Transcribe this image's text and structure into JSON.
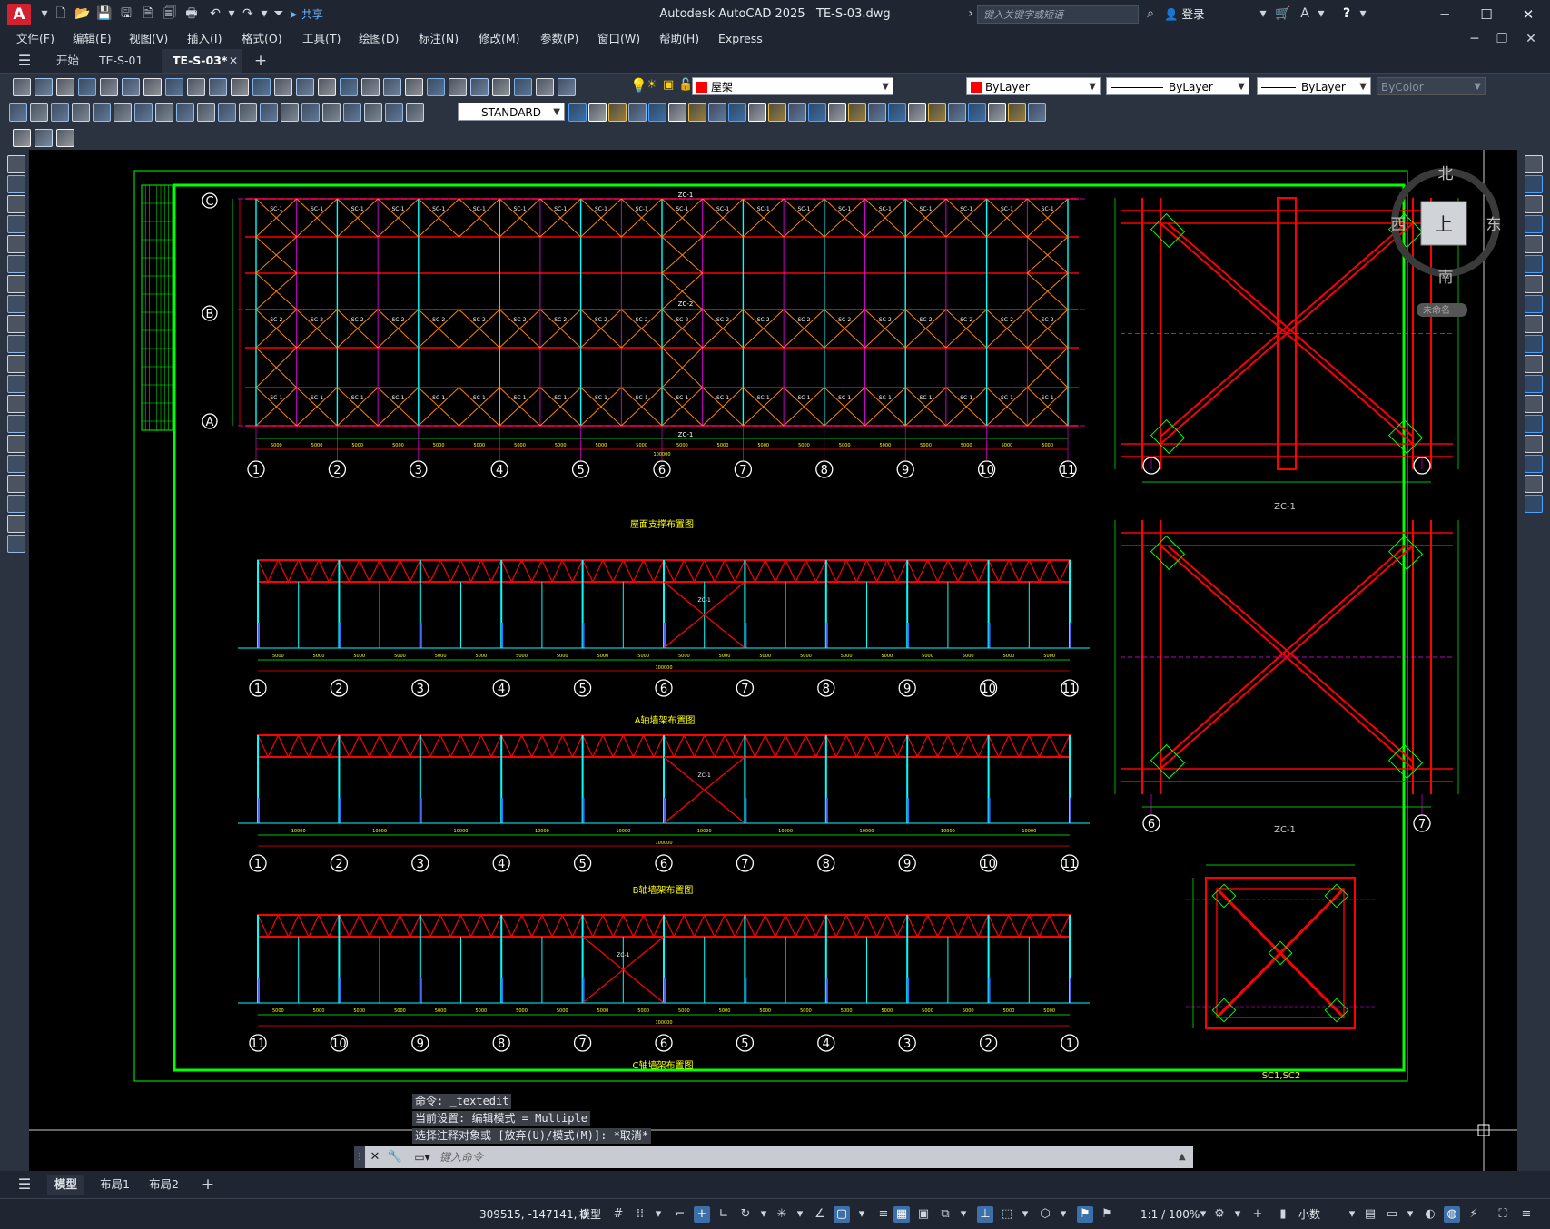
{
  "app": {
    "logo_letter": "A",
    "title": "Autodesk AutoCAD 2025",
    "filename": "TE-S-03.dwg",
    "share_label": "共享",
    "search_placeholder": "键入关键字或短语",
    "login_label": "登录"
  },
  "menu": [
    "文件(F)",
    "编辑(E)",
    "视图(V)",
    "插入(I)",
    "格式(O)",
    "工具(T)",
    "绘图(D)",
    "标注(N)",
    "修改(M)",
    "参数(P)",
    "窗口(W)",
    "帮助(H)",
    "Express"
  ],
  "tabs": {
    "start": "开始",
    "doc1": "TE-S-01",
    "doc2": "TE-S-03*"
  },
  "toolbar": {
    "layer_name": "屋架",
    "color_value": "ByLayer",
    "linetype_value": "ByLayer",
    "lineweight_value": "ByLayer",
    "plotstyle_value": "ByColor",
    "textstyle_value": "STANDARD"
  },
  "viewcube": {
    "north": "北",
    "south": "南",
    "east": "东",
    "west": "西",
    "face": "上",
    "wcs_label": "未命名"
  },
  "drawing": {
    "axis_numbers": [
      "1",
      "2",
      "3",
      "4",
      "5",
      "6",
      "7",
      "8",
      "9",
      "10",
      "11"
    ],
    "axis_numbers_reversed": [
      "11",
      "10",
      "9",
      "8",
      "7",
      "6",
      "5",
      "4",
      "3",
      "2",
      "1"
    ],
    "row_labels": [
      "C",
      "B",
      "A"
    ],
    "titles": {
      "roof_plan": "屋面支撑布置图",
      "axis_a": "A轴墙架布置图",
      "axis_b": "B轴墙架布置图",
      "axis_c": "C轴墙架布置图",
      "zc1_a": "ZC-1",
      "zc1_b": "ZC-1",
      "sc": "SC1,SC2"
    },
    "brace_labels": {
      "row1": "SC-1",
      "row2": "SC-2",
      "row3": "SC-1",
      "zc": "ZC-1",
      "zc2": "ZC-2"
    },
    "dims": {
      "bay": "5000",
      "bay_b": "10000",
      "total": "100000"
    },
    "detail_axes": {
      "left": "6",
      "right": "7"
    }
  },
  "command": {
    "history": [
      "命令: _textedit",
      "当前设置: 编辑模式 = Multiple",
      "选择注释对象或 [放弃(U)/模式(M)]: *取消*"
    ],
    "placeholder": "键入命令"
  },
  "layout_tabs": [
    "模型",
    "布局1",
    "布局2"
  ],
  "status": {
    "coords": "309515, -147141, 0",
    "model": "模型",
    "scale": "1:1 / 100%",
    "units": "小数"
  },
  "colors": {
    "canvas": "#000000",
    "frame": "#00ff00",
    "steel": "#ff0000",
    "brace": "#ff8000",
    "column": "#00ffff",
    "axis": "#ff00ff",
    "text": "#ffffff"
  }
}
